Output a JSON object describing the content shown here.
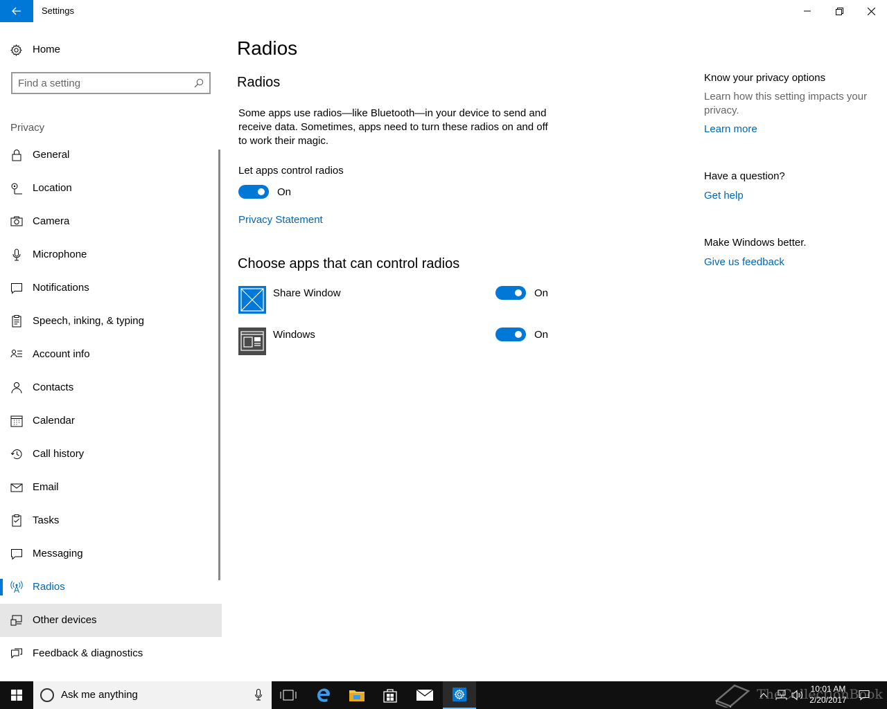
{
  "window": {
    "title": "Settings",
    "controls": {
      "minimize": "minimize",
      "maximize": "restore",
      "close": "close"
    }
  },
  "sidebar": {
    "home_label": "Home",
    "search_placeholder": "Find a setting",
    "section": "Privacy",
    "items": [
      {
        "label": "General",
        "icon": "lock-icon"
      },
      {
        "label": "Location",
        "icon": "location-icon"
      },
      {
        "label": "Camera",
        "icon": "camera-icon"
      },
      {
        "label": "Microphone",
        "icon": "microphone-icon"
      },
      {
        "label": "Notifications",
        "icon": "notifications-icon"
      },
      {
        "label": "Speech, inking, & typing",
        "icon": "speech-icon"
      },
      {
        "label": "Account info",
        "icon": "account-info-icon"
      },
      {
        "label": "Contacts",
        "icon": "contacts-icon"
      },
      {
        "label": "Calendar",
        "icon": "calendar-icon"
      },
      {
        "label": "Call history",
        "icon": "history-icon"
      },
      {
        "label": "Email",
        "icon": "email-icon"
      },
      {
        "label": "Tasks",
        "icon": "tasks-icon"
      },
      {
        "label": "Messaging",
        "icon": "messaging-icon"
      },
      {
        "label": "Radios",
        "icon": "radios-icon"
      },
      {
        "label": "Other devices",
        "icon": "other-devices-icon"
      },
      {
        "label": "Feedback & diagnostics",
        "icon": "feedback-icon"
      }
    ],
    "active_item": "Radios",
    "hovered_item": "Other devices"
  },
  "main": {
    "page_title": "Radios",
    "sub_title": "Radios",
    "description": "Some apps use radios—like Bluetooth—in your device to send and receive data. Sometimes, apps need to turn these radios on and off to work their magic.",
    "master_toggle": {
      "label": "Let apps control radios",
      "state": "On",
      "on": true
    },
    "privacy_link": "Privacy Statement",
    "apps_title": "Choose apps that can control radios",
    "apps": [
      {
        "name": "Share Window",
        "state": "On",
        "on": true,
        "icon": "share-window-app-icon"
      },
      {
        "name": "Windows",
        "state": "On",
        "on": true,
        "icon": "windows-app-icon"
      }
    ]
  },
  "aside": {
    "privacy_heading": "Know your privacy options",
    "privacy_text": "Learn how this setting impacts your privacy.",
    "learn_more": "Learn more",
    "question_heading": "Have a question?",
    "get_help": "Get help",
    "better_heading": "Make Windows better.",
    "feedback_link": "Give us feedback"
  },
  "taskbar": {
    "search_placeholder": "Ask me anything",
    "time": "10:01 AM",
    "date": "2/20/2017",
    "watermark": "TheCollectionBook",
    "accent": "#76b9ed"
  },
  "colors": {
    "accent": "#0078d7",
    "link": "#0067b8",
    "hover": "#e6e6e6",
    "taskbar": "#101010"
  }
}
